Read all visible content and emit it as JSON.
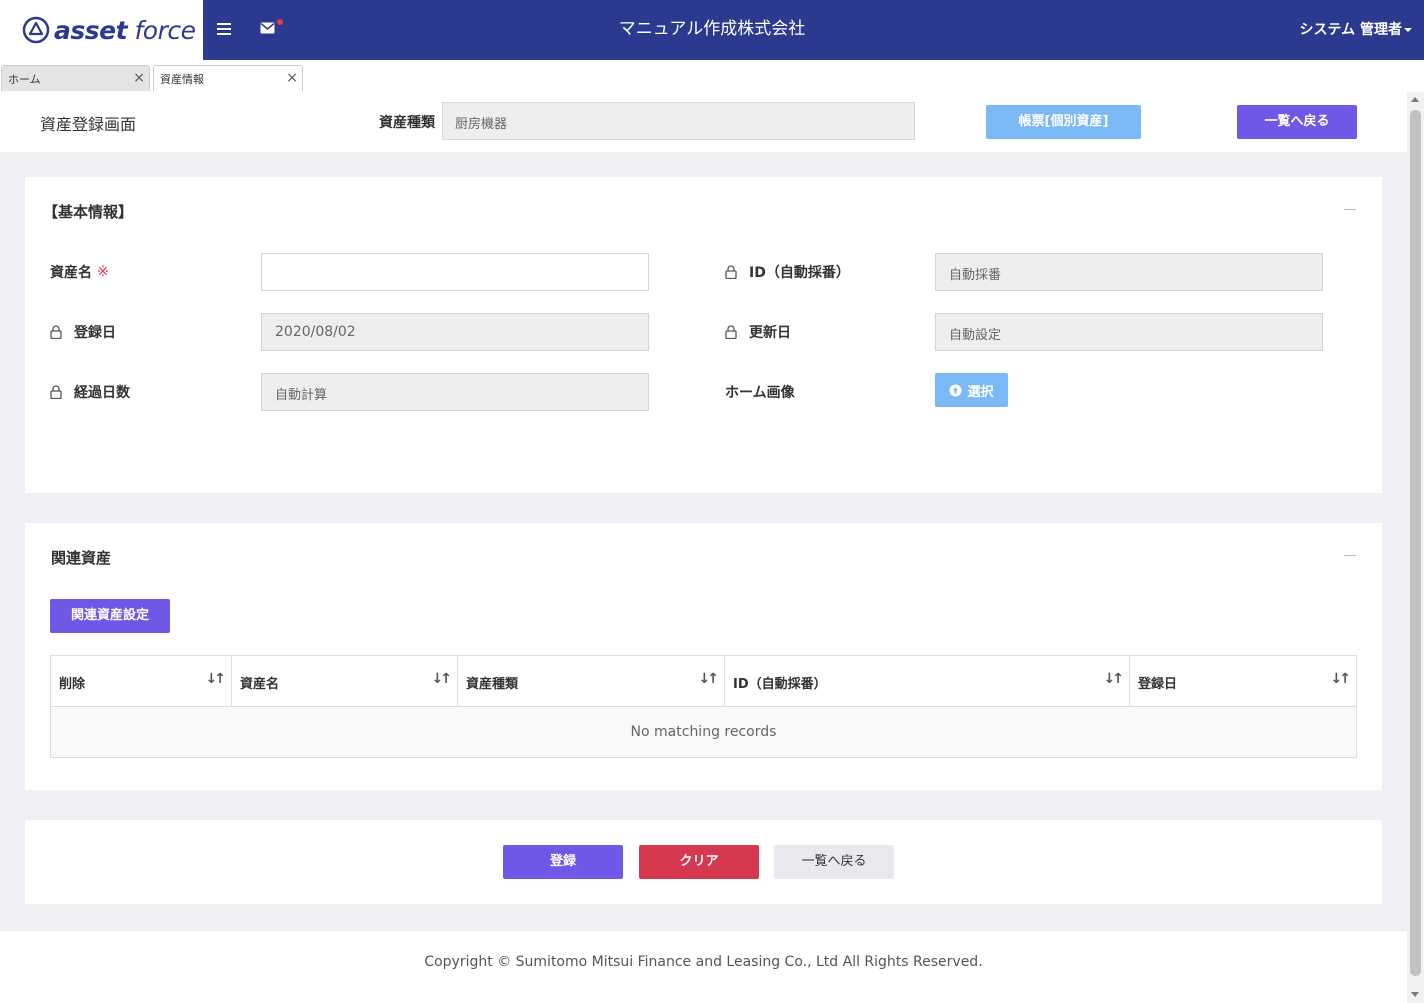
{
  "header": {
    "logo_bold": "asset",
    "logo_light": "force",
    "company": "マニュアル作成株式会社",
    "user": "システム 管理者"
  },
  "tabs": [
    {
      "label": "ホーム",
      "close": "×"
    },
    {
      "label": "資産情報",
      "close": "×"
    }
  ],
  "page": {
    "title": "資産登録画面",
    "type_label": "資産種類",
    "type_value": "厨房機器",
    "form_button": "帳票[個別資産]",
    "back_button": "一覧へ戻る"
  },
  "basic": {
    "title": "【基本情報】",
    "asset_name_label": "資産名",
    "required_mark": "※",
    "asset_name_value": "",
    "id_label": "ID（自動採番）",
    "id_value": "自動採番",
    "reg_date_label": "登録日",
    "reg_date_value": "2020/08/02",
    "upd_date_label": "更新日",
    "upd_date_value": "自動設定",
    "elapsed_label": "経過日数",
    "elapsed_value": "自動計算",
    "home_image_label": "ホーム画像",
    "select_button": "選択"
  },
  "related": {
    "title": "関連資産",
    "setting_button": "関連資産設定",
    "columns": [
      "削除",
      "資産名",
      "資産種類",
      "ID（自動採番）",
      "登録日"
    ],
    "sort_icon": "↓↑",
    "empty_text": "No matching records"
  },
  "actions": {
    "register": "登録",
    "clear": "クリア",
    "back": "一覧へ戻る"
  },
  "footer": {
    "copyright": "Copyright © Sumitomo Mitsui Finance and Leasing Co., Ltd All Rights Reserved."
  },
  "colors": {
    "header_bg": "#2b3a8f",
    "primary": "#7057e6",
    "info": "#7ab8f6",
    "danger": "#d4394f"
  }
}
